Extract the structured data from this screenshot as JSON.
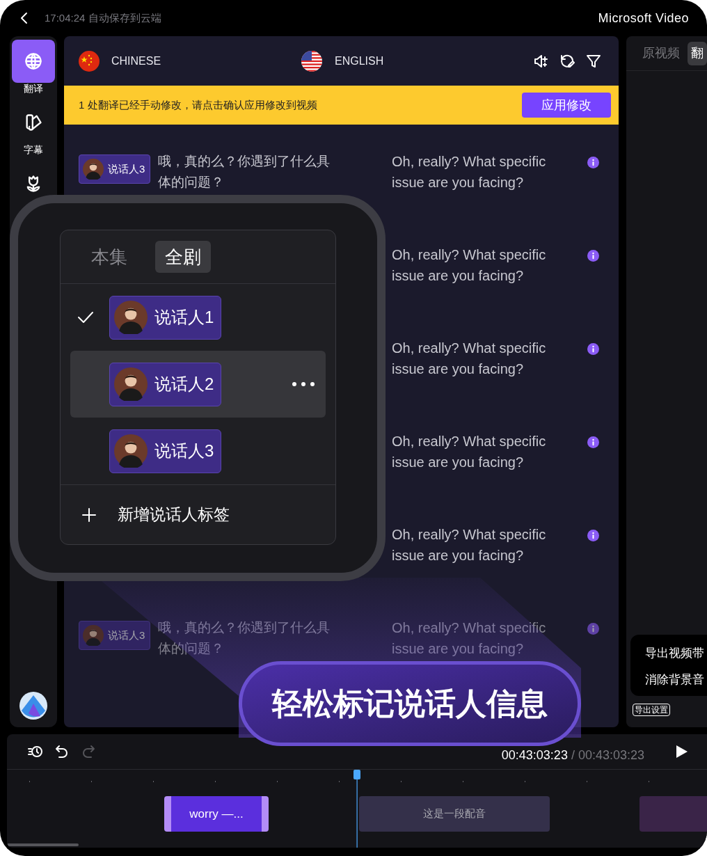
{
  "top_bar": {
    "save_status": "17:04:24 自动保存到云端",
    "app_name": "Microsoft Video"
  },
  "sidebar": {
    "items": [
      {
        "kind": "globe",
        "label": "翻译",
        "selected": true
      },
      {
        "kind": "palette",
        "label": "字幕",
        "selected": false
      },
      {
        "kind": "flower",
        "selected": false
      }
    ]
  },
  "editor": {
    "source_language": "CHINESE",
    "target_language": "ENGLISH",
    "notice": {
      "text": "1 处翻译已经手动修改，请点击确认应用修改到视频",
      "button": "应用修改"
    },
    "rows": [
      {
        "speaker": "说话人3",
        "source": "哦，真的么？你遇到了什么具体的问题？",
        "target": "Oh, really? What specific issue are you facing?",
        "faded": false
      },
      {
        "target": "Oh, really? What specific issue are you facing?",
        "faded": false
      },
      {
        "target": "Oh, really? What specific issue are you facing?",
        "faded": false
      },
      {
        "target": "Oh, really? What specific issue are you facing?",
        "faded": false
      },
      {
        "target": "Oh, really? What specific issue are you facing?",
        "faded": false
      },
      {
        "speaker": "说话人3",
        "source": "哦，真的么？你遇到了什么具体的问题？",
        "target": "Oh, really? What specific issue are you facing?",
        "faded": true
      }
    ]
  },
  "right_panel": {
    "tabs": [
      {
        "label": "原视频",
        "selected": false
      },
      {
        "label": "翻",
        "selected": true
      }
    ],
    "menu": [
      "导出视频带",
      "消除背景音"
    ],
    "export_button": "导出设置"
  },
  "speaker_popup": {
    "tabs": [
      {
        "label": "本集",
        "selected": false
      },
      {
        "label": "全剧",
        "selected": true
      }
    ],
    "speakers": [
      {
        "name": "说话人1",
        "checked": true,
        "hovered": false
      },
      {
        "name": "说话人2",
        "checked": false,
        "hovered": true
      },
      {
        "name": "说话人3",
        "checked": false,
        "hovered": false
      }
    ],
    "add_label": "新增说话人标签"
  },
  "promo_banner": "轻松标记说话人信息",
  "timeline": {
    "tools": [
      {
        "kind": "history",
        "disabled": false
      },
      {
        "kind": "undo",
        "disabled": false
      },
      {
        "kind": "redo",
        "disabled": true
      }
    ],
    "current_time": "00:43:03:23",
    "separator": "/",
    "total_time": "00:43:03:23",
    "clips": [
      {
        "kind": "subtitle",
        "label": "worry —..."
      },
      {
        "kind": "dub",
        "label": "这是一段配音"
      },
      {
        "kind": "textured"
      }
    ]
  }
}
